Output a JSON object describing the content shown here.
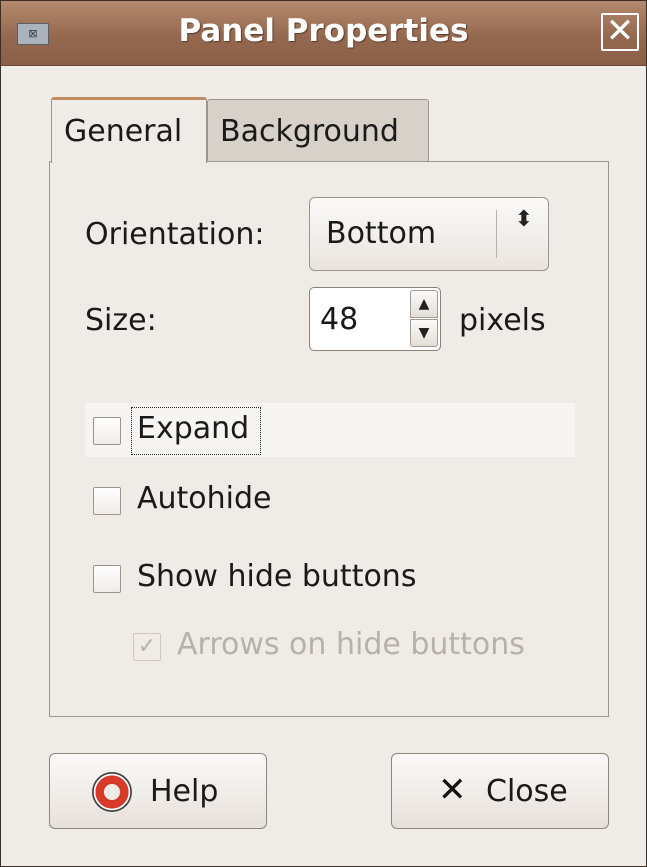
{
  "window": {
    "title": "Panel Properties",
    "close_glyph": "✕",
    "app_icon_glyph": "⊠"
  },
  "tabs": [
    {
      "label": "General",
      "selected": true
    },
    {
      "label": "Background",
      "selected": false
    }
  ],
  "general": {
    "orientation_label": "Orientation:",
    "orientation_value": "Bottom",
    "size_label": "Size:",
    "size_value": "48",
    "size_unit": "pixels",
    "expand_label": "Expand",
    "expand_checked": false,
    "autohide_label": "Autohide",
    "autohide_checked": false,
    "show_hide_buttons_label": "Show hide buttons",
    "show_hide_buttons_checked": false,
    "arrows_label": "Arrows on hide buttons",
    "arrows_checked": true,
    "arrows_enabled": false
  },
  "buttons": {
    "help_label": "Help",
    "close_label": "Close"
  },
  "icons": {
    "combo_arrows": "⬍",
    "spin_up": "▲",
    "spin_down": "▼",
    "check_mark": "✓",
    "close_button": "✕",
    "help_button": "lifebuoy-icon"
  },
  "colors": {
    "titlebar": "#95694f",
    "dialog_background": "#efebe7",
    "tab_accent": "#c18c5e"
  }
}
